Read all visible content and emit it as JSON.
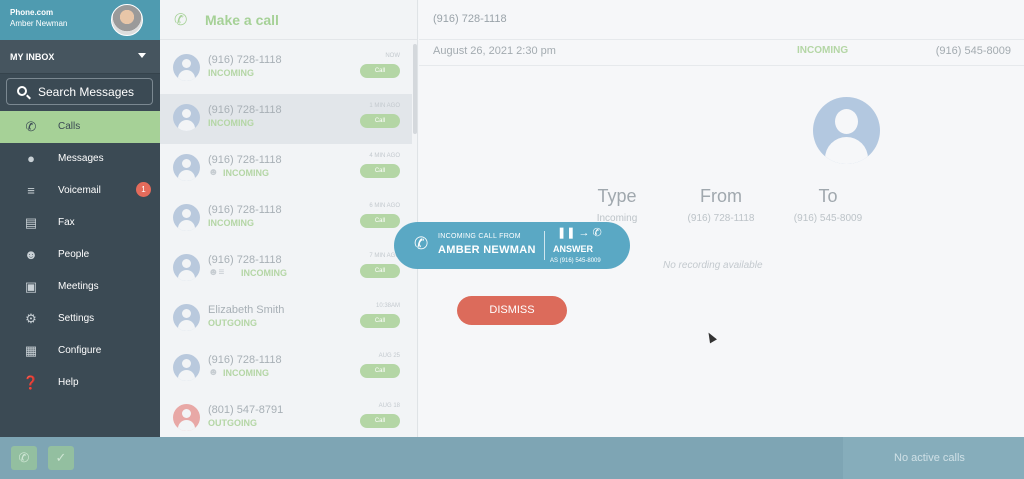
{
  "brand": {
    "company": "Phone.com",
    "user": "Amber Newman"
  },
  "inbox": {
    "label": "MY INBOX"
  },
  "search": {
    "label": "Search Messages"
  },
  "nav": [
    {
      "label": "Calls",
      "icon": "calls-icon",
      "active": true
    },
    {
      "label": "Messages",
      "icon": "messages-icon"
    },
    {
      "label": "Voicemail",
      "icon": "voicemail-icon",
      "badge": "1"
    },
    {
      "label": "Fax",
      "icon": "fax-icon"
    },
    {
      "label": "People",
      "icon": "people-icon"
    },
    {
      "label": "Meetings",
      "icon": "meetings-icon"
    },
    {
      "label": "Settings",
      "icon": "gear-icon"
    },
    {
      "label": "Configure",
      "icon": "configure-icon"
    },
    {
      "label": "Help",
      "icon": "help-icon"
    }
  ],
  "list": {
    "make_call": "Make a call",
    "call_label": "Call",
    "rows": [
      {
        "name": "(916) 728-1118",
        "status": "INCOMING",
        "time": "NOW"
      },
      {
        "name": "(916) 728-1118",
        "status": "INCOMING",
        "time": "1 MIN AGO"
      },
      {
        "name": "(916) 728-1118",
        "status": "INCOMING",
        "time": "4 MIN AGO"
      },
      {
        "name": "(916) 728-1118",
        "status": "INCOMING",
        "time": "6 MIN AGO"
      },
      {
        "name": "(916) 728-1118",
        "status": "INCOMING",
        "time": "7 MIN AGO"
      },
      {
        "name": "Elizabeth Smith",
        "status": "OUTGOING",
        "time": "10:38AM"
      },
      {
        "name": "(916) 728-1118",
        "status": "INCOMING",
        "time": "AUG 25"
      },
      {
        "name": "(801) 547-8791",
        "status": "OUTGOING",
        "time": "AUG 18"
      }
    ]
  },
  "detail": {
    "header_number": "(916) 728-1118",
    "datetime": "August 26, 2021 2:30 pm",
    "direction": "INCOMING",
    "to_number": "(916) 545-8009",
    "type_label": "Type",
    "type_value": "Incoming",
    "from_label": "From",
    "from_value": "(916) 728-1118",
    "to_label": "To",
    "to_value": "(916) 545-8009",
    "no_recording": "No recording available"
  },
  "incoming_call": {
    "line1": "INCOMING CALL FROM",
    "caller": "AMBER NEWMAN",
    "answer": "ANSWER",
    "as_number": "AS (916) 545-8009"
  },
  "dismiss": "DISMISS",
  "bottom": {
    "status": "No active calls"
  }
}
